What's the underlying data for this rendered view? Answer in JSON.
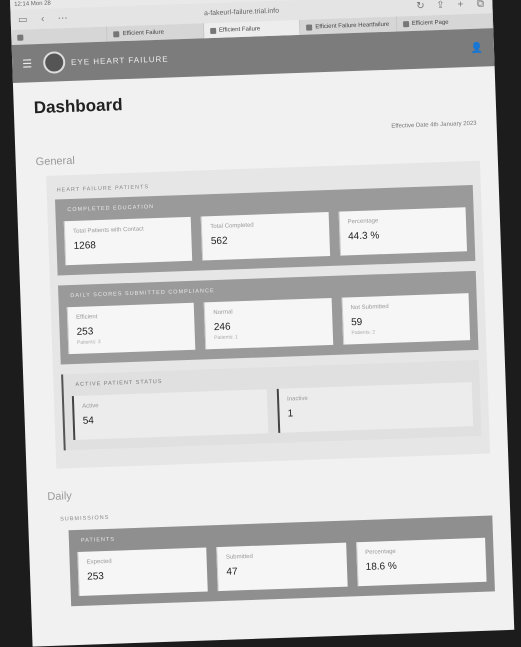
{
  "browser": {
    "status_time": "12:14 Mon 28",
    "url": "a-fakeurl-failure.trial.info",
    "tabs": [
      {
        "label": "",
        "active": false
      },
      {
        "label": "Efficient Failure",
        "active": false
      },
      {
        "label": "Efficient Failure",
        "active": true
      },
      {
        "label": "Efficient Failure Heartfailure",
        "active": false
      },
      {
        "label": "Efficient Page",
        "active": false
      }
    ]
  },
  "app": {
    "title": "EYE HEART FAILURE"
  },
  "page": {
    "title": "Dashboard",
    "effective_date": "Effective Date 4th January 2023"
  },
  "general": {
    "title": "General",
    "panel_label": "HEART FAILURE PATIENTS",
    "groups": [
      {
        "label": "COMPLETED EDUCATION",
        "cards": [
          {
            "label": "Total Patients with Contact",
            "value": "1268",
            "sub": ""
          },
          {
            "label": "Total Completed",
            "value": "562",
            "sub": ""
          },
          {
            "label": "Percentage",
            "value": "44.3 %",
            "sub": ""
          }
        ]
      },
      {
        "label": "DAILY SCORES SUBMITTED COMPLIANCE",
        "cards": [
          {
            "label": "Efficient",
            "value": "253",
            "sub": "Patients: 3"
          },
          {
            "label": "Normal",
            "value": "246",
            "sub": "Patients: 1"
          },
          {
            "label": "Not Submitted",
            "value": "59",
            "sub": "Patients: 2"
          }
        ]
      }
    ],
    "status_group": {
      "label": "ACTIVE PATIENT STATUS",
      "cards": [
        {
          "label": "Active",
          "value": "54",
          "sub": ""
        },
        {
          "label": "Inactive",
          "value": "1",
          "sub": ""
        }
      ]
    }
  },
  "daily": {
    "title": "Daily",
    "panel_label": "SUBMISSIONS",
    "group_label": "PATIENTS",
    "cards": [
      {
        "label": "Expected",
        "value": "253",
        "sub": ""
      },
      {
        "label": "Submitted",
        "value": "47",
        "sub": ""
      },
      {
        "label": "Percentage",
        "value": "18.6 %",
        "sub": ""
      }
    ]
  }
}
